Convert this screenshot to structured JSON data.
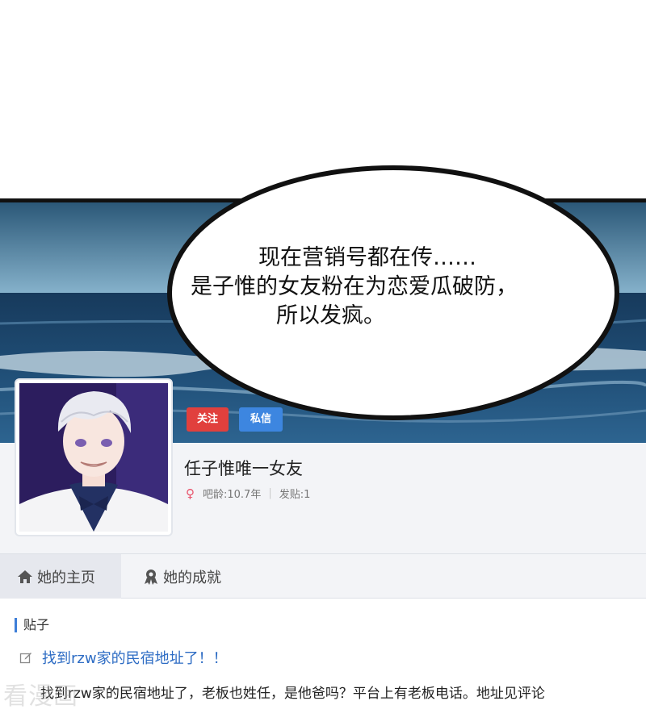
{
  "speech_bubble": {
    "line1": "现在营销号都在传……",
    "line2": "是子惟的女友粉在为恋爱瓜破防，",
    "line3": "所以发疯。"
  },
  "profile": {
    "follow_label": "关注",
    "message_label": "私信",
    "username": "任子惟唯一女友",
    "gender_icon": "♀",
    "age_text": "吧龄:10.7年",
    "posts_text": "发贴:1"
  },
  "tabs": [
    {
      "label": "她的主页",
      "icon": "home-icon"
    },
    {
      "label": "她的成就",
      "icon": "medal-icon"
    }
  ],
  "posts_section": {
    "title": "贴子",
    "post_title": "找到rzw家的民宿地址了！！",
    "post_body": "找到rzw家的民宿地址了，老板也姓任，是他爸吗？平台上有老板电话。地址见评论"
  },
  "watermark": "看漫画",
  "colors": {
    "follow": "#e1403d",
    "message": "#3d86e0",
    "link": "#2d6cc4",
    "female": "#e8536b"
  }
}
